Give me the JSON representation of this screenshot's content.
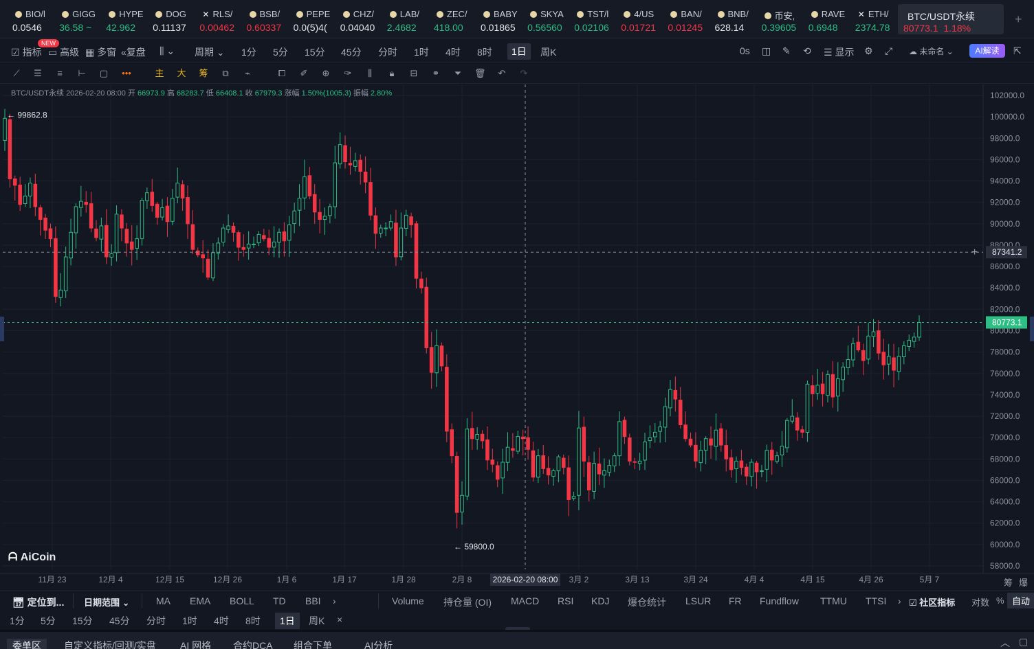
{
  "ticker": [
    {
      "name": "BIO/l",
      "price": "0.0546",
      "color": "wh",
      "icon": "coin-icon"
    },
    {
      "name": "GIGG",
      "price": "36.58 ~",
      "color": "up",
      "icon": "coin-icon"
    },
    {
      "name": "HYPE",
      "price": "42.962",
      "color": "up",
      "icon": "coin-icon"
    },
    {
      "name": "DOG",
      "price": "0.11137",
      "color": "wh",
      "icon": "coin-icon"
    },
    {
      "name": "RLS/",
      "price": "0.00462",
      "color": "dn",
      "icon": "close-icon"
    },
    {
      "name": "BSB/",
      "price": "0.60337",
      "color": "dn",
      "icon": "coin-icon"
    },
    {
      "name": "PEPE",
      "price": "0.0(5)4(",
      "color": "wh",
      "icon": "coin-icon"
    },
    {
      "name": "CHZ/",
      "price": "0.04040",
      "color": "wh",
      "icon": "coin-icon"
    },
    {
      "name": "LAB/",
      "price": "2.4682",
      "color": "up",
      "icon": "coin-icon"
    },
    {
      "name": "ZEC/",
      "price": "418.00",
      "color": "up",
      "icon": "coin-icon"
    },
    {
      "name": "BABY",
      "price": "0.01865",
      "color": "wh",
      "icon": "coin-icon"
    },
    {
      "name": "SKYA",
      "price": "0.56560",
      "color": "up",
      "icon": "coin-icon"
    },
    {
      "name": "TST/l",
      "price": "0.02106",
      "color": "up",
      "icon": "coin-icon"
    },
    {
      "name": "4/US",
      "price": "0.01721",
      "color": "dn",
      "icon": "coin-icon"
    },
    {
      "name": "BAN/",
      "price": "0.01245",
      "color": "dn",
      "icon": "coin-icon"
    },
    {
      "name": "BNB/",
      "price": "628.14",
      "color": "wh",
      "icon": "coin-icon"
    },
    {
      "name": "币安,",
      "price": "0.39605",
      "color": "up",
      "icon": "coin-icon"
    },
    {
      "name": "RAVE",
      "price": "0.6948",
      "color": "up",
      "icon": "coin-icon"
    },
    {
      "name": "ETH/",
      "price": "2374.78",
      "color": "up",
      "icon": "close-icon"
    }
  ],
  "active_ticker": {
    "name": "BTC/USDT永续",
    "price": "80773.1",
    "change": "1.18%"
  },
  "toolbar": {
    "indicators": "指标",
    "new_badge": "NEW",
    "advanced": "高级",
    "multi": "多窗",
    "replay": "复盘",
    "period": "周期",
    "intervals": [
      "1分",
      "5分",
      "15分",
      "45分",
      "分时",
      "1时",
      "4时",
      "8时",
      "1日",
      "周K"
    ],
    "selected_interval": "1日",
    "countdown": "0s",
    "display": "显示",
    "layout_name": "未命名",
    "ai_label": "AI解读"
  },
  "draw_tools": {
    "main": "主",
    "big": "大",
    "chip": "筹"
  },
  "info_bar": {
    "symbol": "BTC/USDT永续",
    "date": "2026-02-20 08:00",
    "open_label": "开",
    "open": "66973.9",
    "high_label": "高",
    "high": "68283.7",
    "low_label": "低",
    "low": "66408.1",
    "close_label": "收",
    "close": "67979.3",
    "change_label": "涨幅",
    "change": "1.50%(1005.3)",
    "amp_label": "振幅",
    "amp": "2.80%"
  },
  "chart_data": {
    "type": "candlestick",
    "y_ticks": [
      58000,
      60000,
      62000,
      64000,
      66000,
      68000,
      70000,
      72000,
      74000,
      76000,
      78000,
      80000,
      82000,
      84000,
      86000,
      88000,
      90000,
      92000,
      94000,
      96000,
      98000,
      100000,
      102000
    ],
    "ylim": [
      57500,
      102500
    ],
    "x_ticks": [
      "11月 23",
      "12月 4",
      "12月 15",
      "12月 26",
      "1月 6",
      "1月 17",
      "1月 28",
      "2月 8",
      "3月 2",
      "3月 13",
      "3月 24",
      "4月 4",
      "4月 15",
      "4月 26",
      "5月 7"
    ],
    "crosshair_x_label": "2026-02-20 08:00",
    "crosshair_price": "87341.2",
    "last_price": "80773.1",
    "max_label": "99862.8",
    "min_label": "59800.0",
    "colors": {
      "up": "#2ebd85",
      "down": "#f23645"
    },
    "candles_close": [
      99862,
      94200,
      93600,
      91800,
      92600,
      93800,
      91600,
      90400,
      89400,
      88600,
      83200,
      83800,
      86900,
      89200,
      91600,
      92100,
      91800,
      89600,
      88700,
      89800,
      86900,
      87200,
      90900,
      89600,
      88200,
      87600,
      88600,
      92200,
      92900,
      91700,
      90600,
      91500,
      90200,
      92400,
      93800,
      92400,
      90000,
      87600,
      87100,
      86800,
      85000,
      87300,
      88200,
      89600,
      89800,
      89200,
      87800,
      87600,
      88100,
      88100,
      89000,
      88600,
      87800,
      88300,
      89200,
      88400,
      89900,
      91200,
      92400,
      94400,
      92600,
      91100,
      90400,
      90700,
      91600,
      95700,
      97400,
      95800,
      95500,
      95900,
      94900,
      93900,
      90800,
      89100,
      89600,
      89600,
      90200,
      86900,
      89600,
      90800,
      89900,
      84900,
      84000,
      78400,
      76100,
      78600,
      76700,
      70600,
      68300,
      63000,
      64600,
      70800,
      69900,
      70300,
      69700,
      67900,
      67500,
      66100,
      67700,
      69100,
      68800,
      70100,
      69900,
      68900,
      66300,
      68300,
      67100,
      66500,
      66900,
      68200,
      67200,
      64200,
      64500,
      70900,
      67800,
      65100,
      67600,
      66600,
      66900,
      67400,
      68300,
      71500,
      70100,
      67800,
      67700,
      67800,
      69600,
      70000,
      70500,
      71000,
      72900,
      74500,
      73600,
      71200,
      69900,
      69300,
      67800,
      68800,
      69900,
      69300,
      70700,
      69300,
      68000,
      67000,
      67800,
      67200,
      66400,
      67700,
      66800,
      66900,
      68800,
      67900,
      68300,
      69200,
      71600,
      72000,
      70700,
      70500,
      75000,
      74100,
      74900,
      74100,
      75900,
      73800,
      75500,
      76600,
      77300,
      78800,
      78200,
      77200,
      79500,
      79900,
      77900,
      76800,
      77600,
      76300,
      77600,
      78600,
      79100,
      79400,
      80773
    ]
  },
  "bottom": {
    "locate": "定位到...",
    "date_range": "日期范围",
    "indicators": [
      "MA",
      "EMA",
      "BOLL",
      "TD",
      "BBI"
    ],
    "sub_indicators": [
      "Volume",
      "持仓量 (OI)",
      "MACD",
      "RSI",
      "KDJ",
      "爆仓统计",
      "LSUR",
      "FR",
      "Fundflow",
      "TTMU",
      "TTSI"
    ],
    "community": "社区指标",
    "log": "对数",
    "pct": "%",
    "auto": "自动",
    "intervals": [
      "1分",
      "5分",
      "15分",
      "45分",
      "分时",
      "1时",
      "4时",
      "8时",
      "1日",
      "周K"
    ],
    "selected_interval": "1日",
    "tabs": [
      "委单区",
      "自定义指标/回测/实盘",
      "AI 网格",
      "合约DCA",
      "组合下单",
      "AI分析"
    ]
  },
  "brand": "AiCoin",
  "right_labels": {
    "a": "筹",
    "b": "爆"
  }
}
